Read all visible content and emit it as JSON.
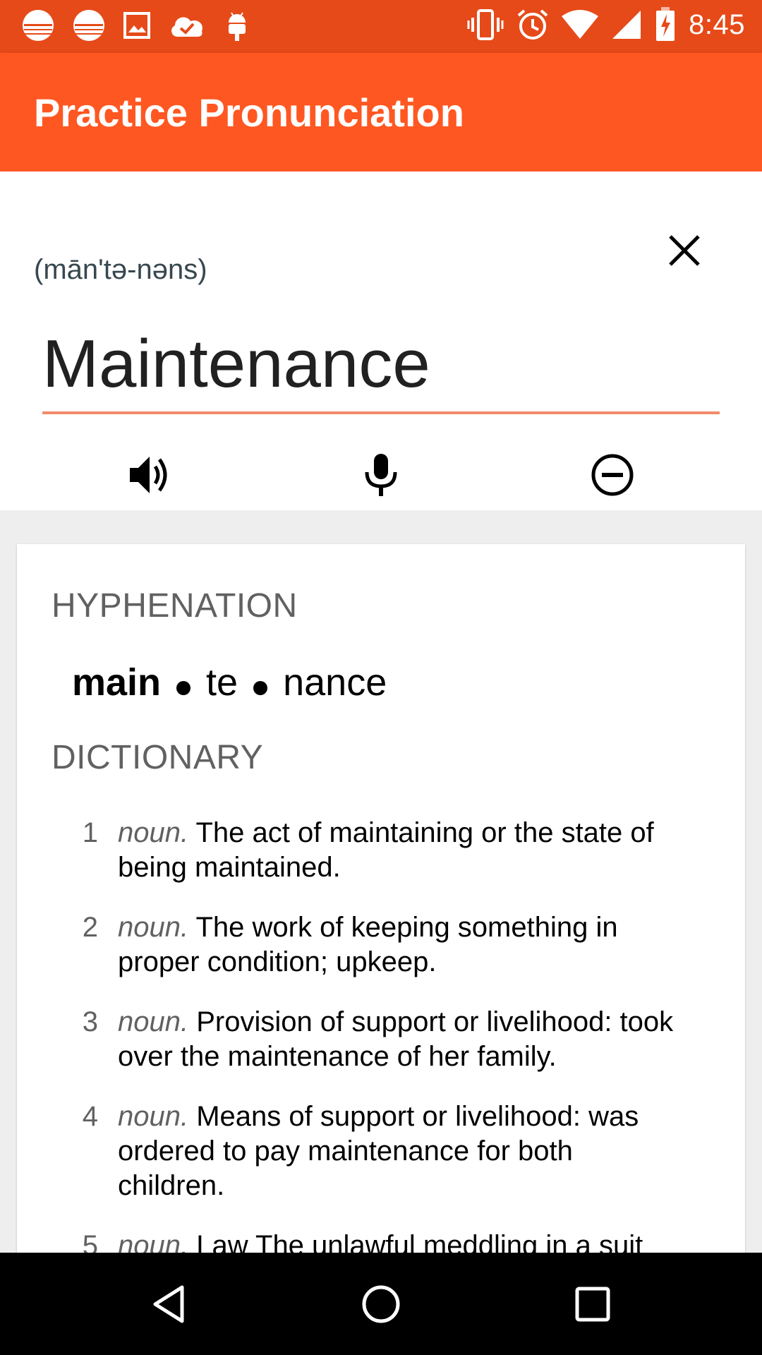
{
  "status_bar": {
    "time": "8:45",
    "left_icons": [
      "sunset-notification-icon",
      "sunset-notification-icon",
      "image-notification-icon",
      "cloud-done-icon",
      "android-icon"
    ],
    "right_icons": [
      "vibrate-icon",
      "alarm-icon",
      "wifi-icon",
      "signal-icon",
      "battery-charging-icon"
    ]
  },
  "app_bar": {
    "title": "Practice Pronunciation"
  },
  "word_panel": {
    "phonetic": "(mān'tə-nəns)",
    "word": "Maintenance"
  },
  "hyphenation": {
    "title": "HYPHENATION",
    "syllables": [
      "main",
      "te",
      "nance"
    ]
  },
  "dictionary": {
    "title": "DICTIONARY",
    "definitions": [
      {
        "num": "1",
        "pos": "noun.",
        "text": "The act of maintaining or the state of being maintained."
      },
      {
        "num": "2",
        "pos": "noun.",
        "text": "The work of keeping something in proper condition; upkeep."
      },
      {
        "num": "3",
        "pos": "noun.",
        "text": "Provision of support or livelihood: took over the maintenance of her family."
      },
      {
        "num": "4",
        "pos": "noun.",
        "text": "Means of support or livelihood: was ordered to pay maintenance for both children."
      },
      {
        "num": "5",
        "pos": "noun.",
        "text": "Law The unlawful meddling in a suit"
      }
    ]
  },
  "colors": {
    "status_bar": "#e64a19",
    "app_bar": "#ff5722",
    "underline": "#f28b6a"
  }
}
